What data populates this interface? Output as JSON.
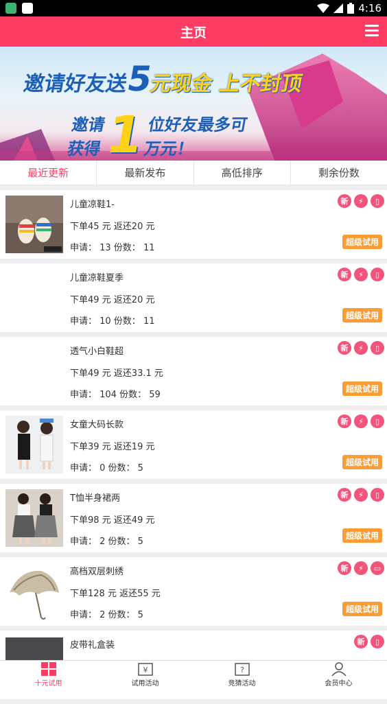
{
  "status_bar": {
    "time": "4:16"
  },
  "header": {
    "title": "主页"
  },
  "banner": {
    "line1_prefix": "邀请好友送",
    "line1_big": "5",
    "line1_suffix": "元现金 上不封顶",
    "line2a": "邀请",
    "line2b": "获得",
    "big_number": "1",
    "line2_tail1": "位好友最多可",
    "line2_tail2": "万元！"
  },
  "tabs": [
    {
      "label": "最近更新",
      "active": true
    },
    {
      "label": "最新发布",
      "active": false
    },
    {
      "label": "高低排序",
      "active": false
    },
    {
      "label": "剩余份数",
      "active": false
    }
  ],
  "products": [
    {
      "title": "儿童凉鞋1-",
      "price": "下单45 元  返还20 元",
      "apply": "申请： 13 份数： 11",
      "badges": [
        "新",
        "闪电",
        "手机"
      ],
      "tag": "超级试用"
    },
    {
      "title": "儿童凉鞋夏季",
      "price": "下单49 元  返还20 元",
      "apply": "申请： 10 份数： 11",
      "badges": [
        "新",
        "闪电",
        "手机"
      ],
      "tag": "超级试用"
    },
    {
      "title": "透气小白鞋超",
      "price": "下单49 元  返还33.1 元",
      "apply": "申请： 104 份数： 59",
      "badges": [
        "新",
        "闪电",
        "手机"
      ],
      "tag": "超级试用"
    },
    {
      "title": "女童大码长款",
      "price": "下单39 元  返还19 元",
      "apply": "申请： 0 份数： 5",
      "badges": [
        "新",
        "闪电",
        "手机"
      ],
      "tag": "超级试用"
    },
    {
      "title": "T恤半身裙两",
      "price": "下单98 元  返还49 元",
      "apply": "申请： 2 份数： 5",
      "badges": [
        "新",
        "闪电",
        "手机"
      ],
      "tag": "超级试用"
    },
    {
      "title": "高档双层刺绣",
      "price": "下单128 元  返还55 元",
      "apply": "申请： 2 份数： 5",
      "badges": [
        "新",
        "闪电",
        "电脑"
      ],
      "tag": "超级试用"
    },
    {
      "title": "皮带礼盒装",
      "price": "",
      "apply": "",
      "badges": [
        "新",
        "手机"
      ],
      "tag": ""
    }
  ],
  "bottom_nav": [
    {
      "label": "十元试用",
      "icon": "grid-icon",
      "active": true
    },
    {
      "label": "试用活动",
      "icon": "yen-icon",
      "active": false
    },
    {
      "label": "竞猜活动",
      "icon": "question-icon",
      "active": false
    },
    {
      "label": "会员中心",
      "icon": "user-icon",
      "active": false
    }
  ],
  "colors": {
    "brand": "#fd3d63",
    "badge": "#f3547b",
    "tag": "#fb9c35"
  }
}
